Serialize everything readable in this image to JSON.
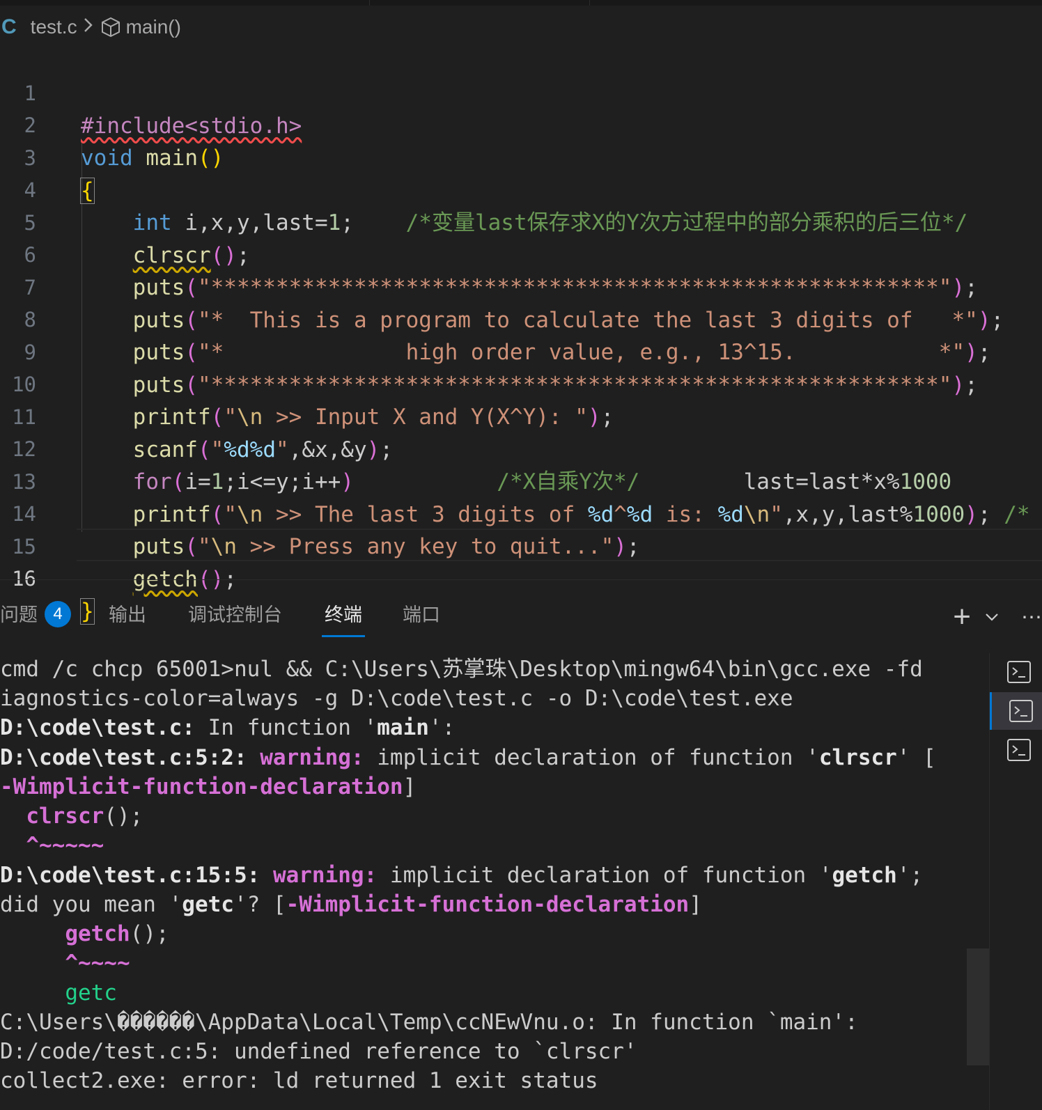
{
  "breadcrumb": {
    "lang_icon_text": "C",
    "file": "test.c",
    "separator": ">",
    "symbol": "main()"
  },
  "editor": {
    "line_numbers": [
      "1",
      "2",
      "3",
      "4",
      "5",
      "6",
      "7",
      "8",
      "9",
      "10",
      "11",
      "12",
      "13",
      "14",
      "15",
      "16"
    ],
    "active_line": "16",
    "lines": {
      "l1": {
        "include": "#include<stdio.h>"
      },
      "l2": {
        "kw": "void",
        "fn": "main",
        "open": "(",
        "close": ")"
      },
      "l3": {
        "brace": "{"
      },
      "l4": {
        "kw": "int",
        "rest": " i,x,y,last=",
        "num": "1",
        "semi": ";",
        "comment": "/*变量last保存求X的Y次方过程中的部分乘积的后三位*/"
      },
      "l5": {
        "fn": "clrscr",
        "paren": "()",
        "semi": ";"
      },
      "l6": {
        "fn": "puts",
        "open": "(",
        "str": "\"********************************************************\"",
        "close": ")",
        "semi": ";"
      },
      "l7": {
        "fn": "puts",
        "open": "(",
        "str": "\"*  This is a program to calculate the last 3 digits of   *\"",
        "close": ")",
        "semi": ";"
      },
      "l8": {
        "fn": "puts",
        "open": "(",
        "str": "\"*              high order value, e.g., 13^15.           *\"",
        "close": ")",
        "semi": ";"
      },
      "l9": {
        "fn": "puts",
        "open": "(",
        "str": "\"********************************************************\"",
        "close": ")",
        "semi": ";"
      },
      "l10": {
        "fn": "printf",
        "open": "(",
        "q1": "\"",
        "esc": "\\n",
        "str": " >> Input X and Y(X^Y): \"",
        "close": ")",
        "semi": ";"
      },
      "l11": {
        "fn": "scanf",
        "open": "(",
        "q1": "\"",
        "fmt": "%d%d",
        "q2": "\"",
        "rest": ",&x,&y",
        "close": ")",
        "semi": ";"
      },
      "l12": {
        "kw": "for",
        "open": "(",
        "rest": "i=",
        "n1": "1",
        "rest2": ";i<=y;i++",
        "close": ")",
        "comment": "/*X自乘Y次*/",
        "tail": "last=last*x%",
        "tailnum": "1000"
      },
      "l13": {
        "fn": "printf",
        "open": "(",
        "q1": "\"",
        "esc": "\\n",
        "s1": " >> The last 3 digits of ",
        "f1": "%d",
        "s2": "^",
        "f2": "%d",
        "s3": " is: ",
        "f3": "%d",
        "esc2": "\\n",
        "q2": "\"",
        "rest": ",x,y,last%",
        "num": "1000",
        "close": ")",
        "semi": ";",
        "comment": " /*"
      },
      "l14": {
        "fn": "puts",
        "open": "(",
        "q1": "\"",
        "esc": "\\n",
        "str": " >> Press any key to quit...\"",
        "close": ")",
        "semi": ";"
      },
      "l15": {
        "fn": "getch",
        "paren": "()",
        "semi": ";"
      },
      "l16": {
        "brace": "}"
      }
    }
  },
  "panel": {
    "tabs": [
      "问题",
      "输出",
      "调试控制台",
      "终端",
      "端口"
    ],
    "active_tab": "终端",
    "problems_count": "4",
    "add_label": "+",
    "more_label": "⋯"
  },
  "terminal": {
    "t1": "cmd /c chcp 65001>nul && C:\\Users\\苏掌珠\\Desktop\\mingw64\\bin\\gcc.exe -fd",
    "t2": "iagnostics-color=always -g D:\\code\\test.c -o D:\\code\\test.exe",
    "t3a": "D:\\code\\test.c:",
    "t3b": " In function '",
    "t3c": "main",
    "t3d": "':",
    "t4a": "D:\\code\\test.c:5:2:",
    "t4b": " warning:",
    "t4c": " implicit declaration of function '",
    "t4d": "clrscr",
    "t4e": "' [",
    "t5a": "-Wimplicit-function-declaration",
    "t5b": "]",
    "t6a": "  ",
    "t6b": "clrscr",
    "t6c": "();",
    "t7": "  ^~~~~~",
    "t8a": "D:\\code\\test.c:15:5:",
    "t8b": " warning:",
    "t8c": " implicit declaration of function '",
    "t8d": "getch",
    "t8e": "';",
    "t9a": "did you mean '",
    "t9b": "getc",
    "t9c": "'? [",
    "t9d": "-Wimplicit-function-declaration",
    "t9e": "]",
    "t10a": "     ",
    "t10b": "getch",
    "t10c": "();",
    "t11": "     ^~~~~",
    "t12": "     getc",
    "t13": "C:\\Users\\������\\AppData\\Local\\Temp\\ccNEwVnu.o: In function `main':",
    "t14": "D:/code/test.c:5: undefined reference to `clrscr'",
    "t15": "collect2.exe: error: ld returned 1 exit status"
  },
  "colors": {
    "accent": "#0078d4",
    "background": "#1f1f1f",
    "warning": "#d670d6",
    "suggestion": "#23d18b"
  },
  "icons": [
    "chevron-right-icon",
    "symbol-method-icon",
    "plus-icon",
    "chevron-down-icon",
    "more-icon",
    "terminal-icon"
  ]
}
